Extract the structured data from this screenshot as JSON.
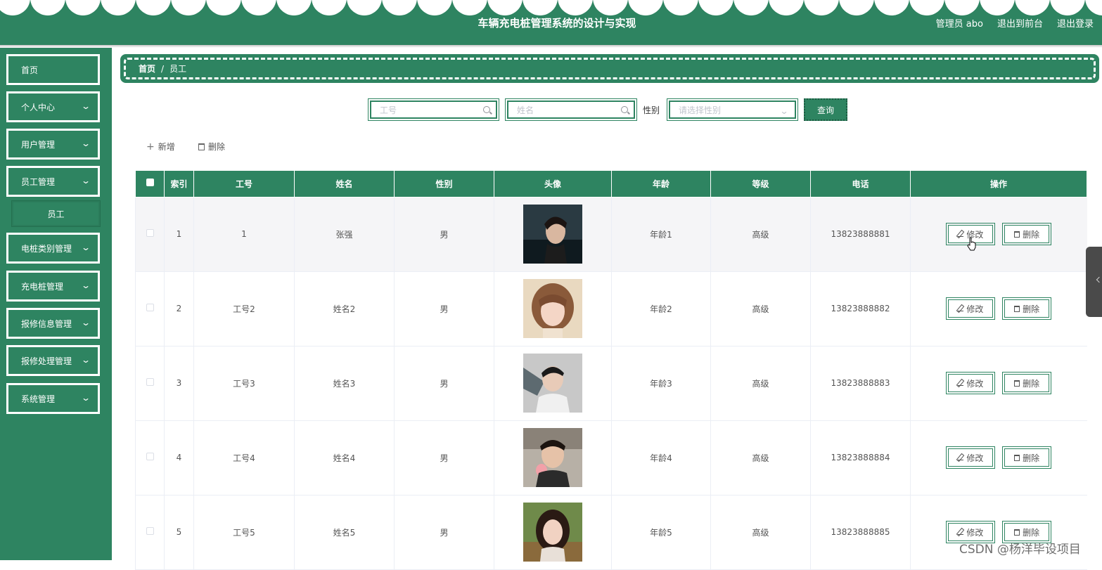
{
  "header": {
    "app_title": "车辆充电桩管理系统的设计与实现",
    "user_label": "管理员 abo",
    "to_front_label": "退出到前台",
    "logout_label": "退出登录"
  },
  "sidebar": {
    "items": [
      {
        "label": "首页"
      },
      {
        "label": "个人中心"
      },
      {
        "label": "用户管理"
      },
      {
        "label": "员工管理"
      },
      {
        "label": "员工"
      },
      {
        "label": "电桩类别管理"
      },
      {
        "label": "充电桩管理"
      },
      {
        "label": "报修信息管理"
      },
      {
        "label": "报修处理管理"
      },
      {
        "label": "系统管理"
      }
    ]
  },
  "breadcrumb": {
    "home": "首页",
    "separator": "/",
    "current": "员工"
  },
  "search": {
    "employee_no_placeholder": "工号",
    "name_placeholder": "姓名",
    "gender_label": "性别",
    "gender_placeholder": "请选择性别",
    "query_label": "查询"
  },
  "toolbar": {
    "add_label": "新增",
    "delete_label": "删除"
  },
  "table": {
    "columns": [
      "索引",
      "工号",
      "姓名",
      "性别",
      "头像",
      "年龄",
      "等级",
      "电话",
      "操作"
    ],
    "edit_label": "修改",
    "delete_label": "删除",
    "rows": [
      {
        "index": "1",
        "employee_no": "1",
        "name": "张强",
        "gender": "男",
        "age": "年龄1",
        "level": "高级",
        "phone": "13823888881"
      },
      {
        "index": "2",
        "employee_no": "工号2",
        "name": "姓名2",
        "gender": "男",
        "age": "年龄2",
        "level": "高级",
        "phone": "13823888882"
      },
      {
        "index": "3",
        "employee_no": "工号3",
        "name": "姓名3",
        "gender": "男",
        "age": "年龄3",
        "level": "高级",
        "phone": "13823888883"
      },
      {
        "index": "4",
        "employee_no": "工号4",
        "name": "姓名4",
        "gender": "男",
        "age": "年龄4",
        "level": "高级",
        "phone": "13823888884"
      },
      {
        "index": "5",
        "employee_no": "工号5",
        "name": "姓名5",
        "gender": "男",
        "age": "年龄5",
        "level": "高级",
        "phone": "13823888885"
      }
    ]
  },
  "watermark": "CSDN @杨洋毕设项目",
  "colors": {
    "primary": "#2e8461",
    "header_bg": "#2e8461",
    "row_highlight": "#f5f5f7"
  }
}
